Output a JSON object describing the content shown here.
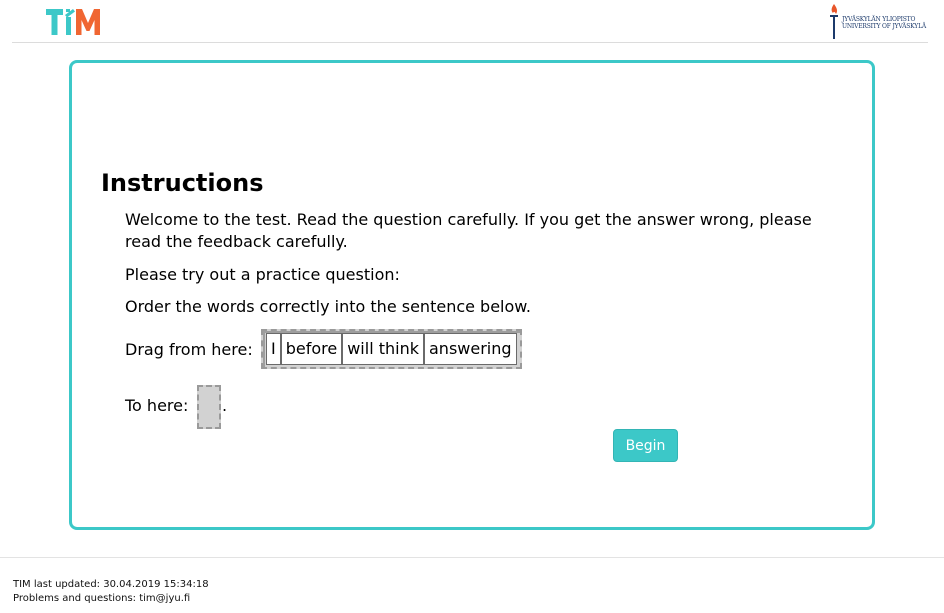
{
  "header": {
    "app_logo_text": "TIM",
    "university_logo_line1": "JYVÄSKYLÄN YLIOPISTO",
    "university_logo_line2": "UNIVERSITY OF JYVÄSKYLÄ"
  },
  "instructions": {
    "heading": "Instructions",
    "paragraph1": "Welcome to the test. Read the question carefully. If you get the answer wrong, please read the feedback carefully.",
    "paragraph2": "Please try out a practice question:",
    "paragraph3": "Order the words correctly into the sentence below.",
    "drag_label": "Drag from here:",
    "words": [
      "I",
      "before",
      "will think",
      "answering"
    ],
    "to_label": "To here:",
    "sentence_end": ".",
    "begin_label": "Begin"
  },
  "footer": {
    "last_updated": "TIM last updated: 30.04.2019 15:34:18",
    "contact": "Problems and questions: tim@jyu.fi"
  },
  "colors": {
    "accent": "#3cc8c8",
    "tim_teal": "#3cc8c8",
    "tim_orange": "#f06632"
  }
}
